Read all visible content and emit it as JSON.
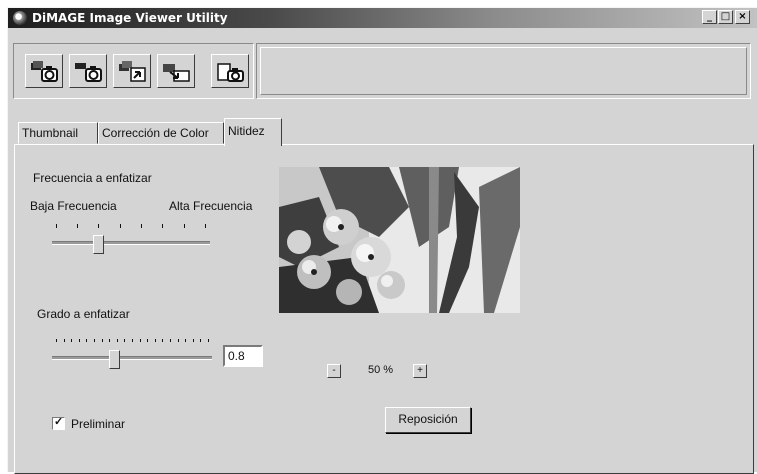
{
  "window": {
    "title": "DiMAGE Image Viewer Utility",
    "controls": {
      "minimize": "_",
      "maximize": "□",
      "close": "×"
    }
  },
  "toolbar": {
    "buttons": [
      {
        "icon": "cards-to-camera-icon"
      },
      {
        "icon": "camera-to-cards-icon"
      },
      {
        "icon": "cards-refresh-icon"
      },
      {
        "icon": "cards-swap-icon"
      },
      {
        "icon": "camera-settings-icon"
      }
    ]
  },
  "tabs": [
    {
      "label": "Thumbnail"
    },
    {
      "label": "Corrección de Color"
    },
    {
      "label": "Nitidez"
    }
  ],
  "active_tab": "Nitidez",
  "frequency": {
    "title": "Frecuencia a enfatizar",
    "low_label": "Baja Frecuencia",
    "high_label": "Alta Frecuencia",
    "value_fraction": 0.3
  },
  "degree": {
    "title": "Grado a enfatizar",
    "value": "0.8",
    "value_fraction": 0.4
  },
  "zoom": {
    "minus": "-",
    "value": "50 %",
    "plus": "+"
  },
  "reset_button": "Reposición",
  "preview_checkbox": {
    "label": "Preliminar",
    "checked": true,
    "mark": "✓"
  },
  "colors": {
    "window_bg": "#d4d4d4",
    "title_dark": "#1e1e1e",
    "title_light": "#c2c2c2"
  }
}
